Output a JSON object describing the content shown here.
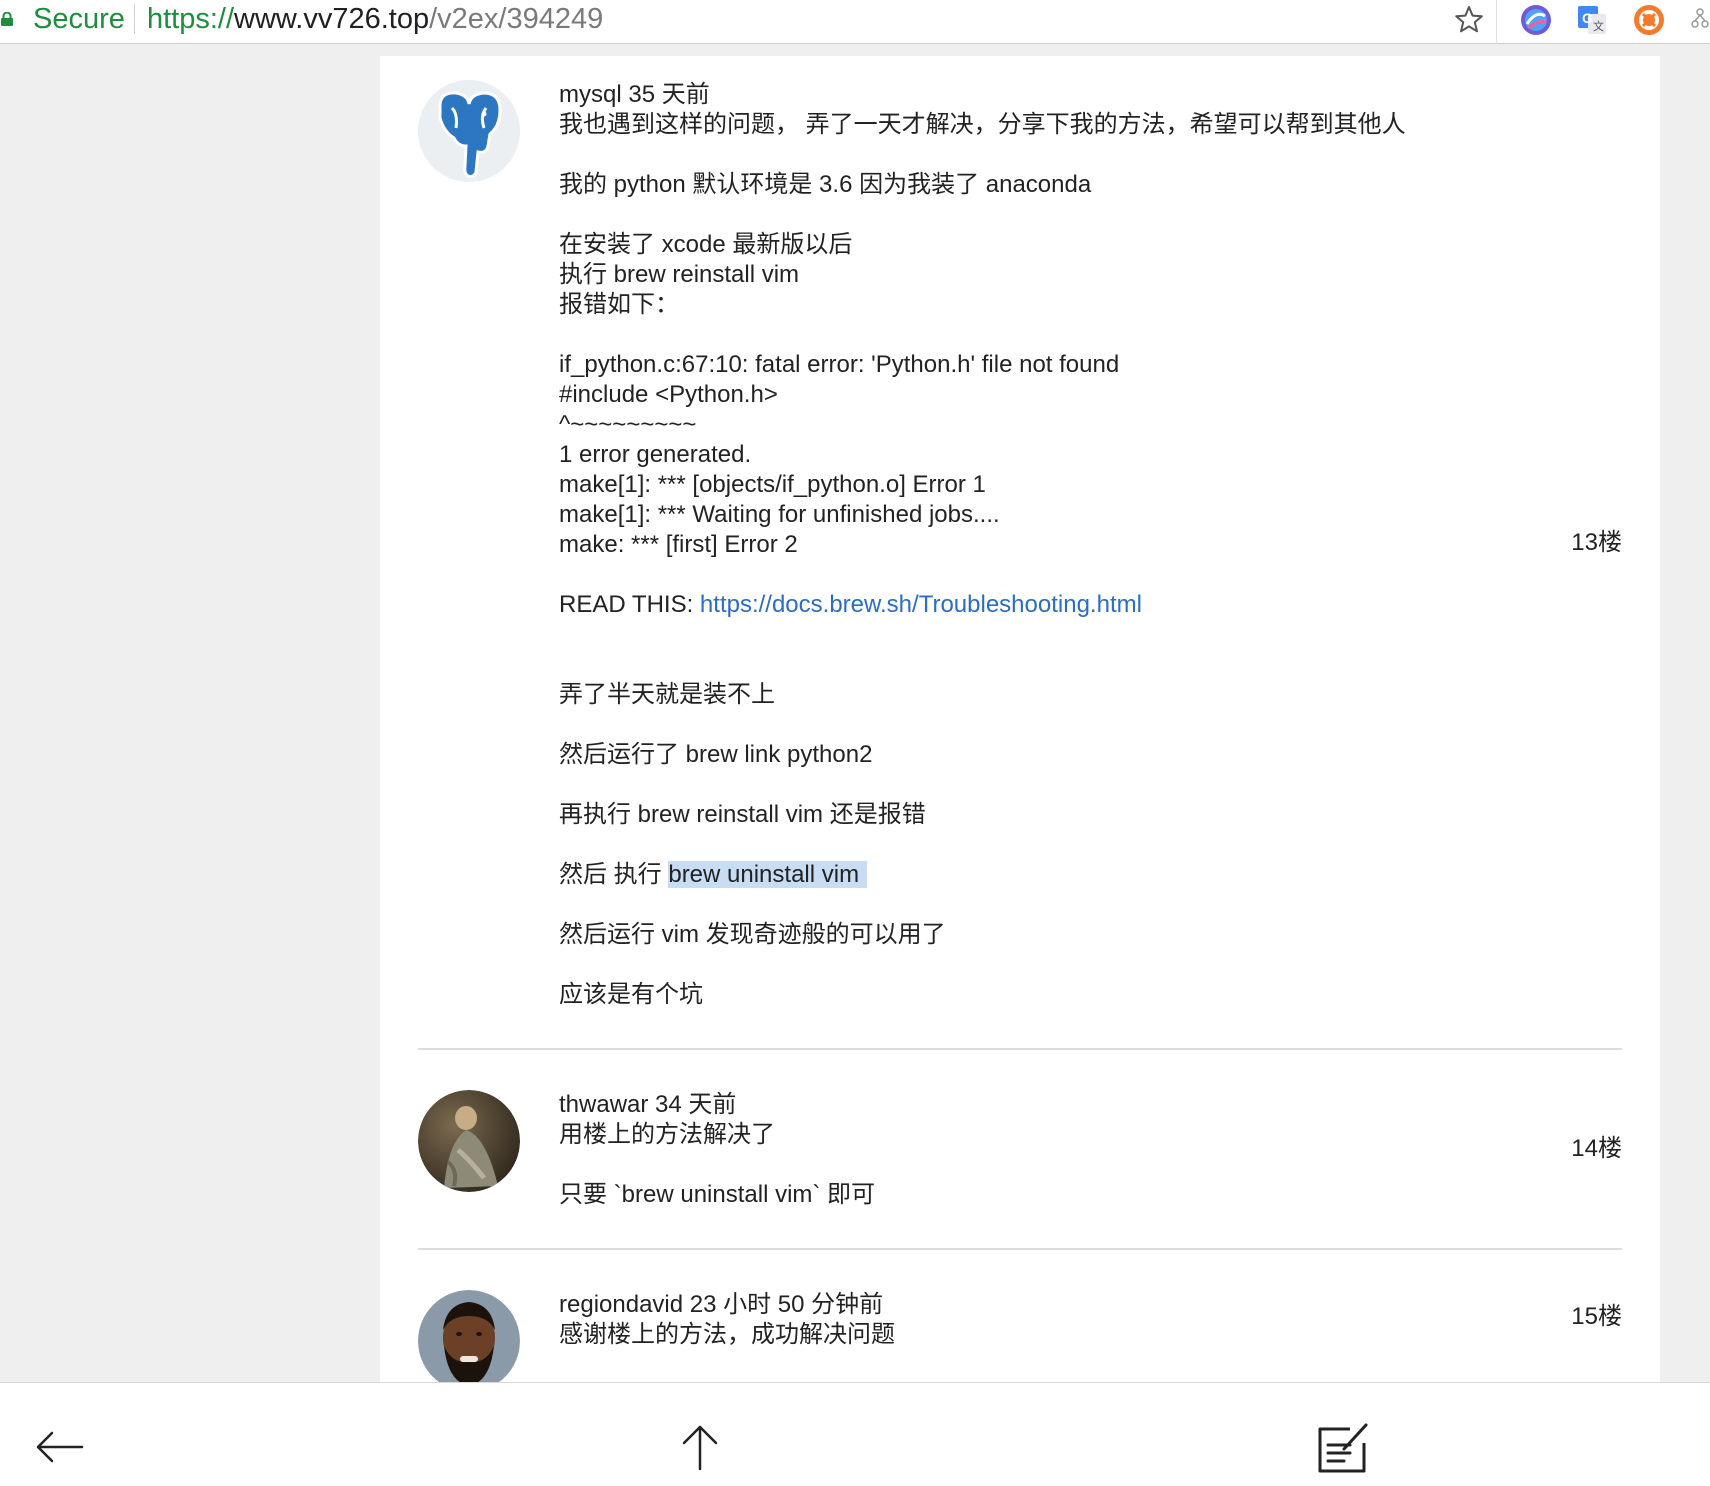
{
  "browser": {
    "secure_label": "Secure",
    "url_scheme": "https://",
    "url_host": "www.vv726.top",
    "url_path": "/v2ex/394249"
  },
  "replies": [
    {
      "username": "mysql",
      "time": "35 天前",
      "floor": "13楼",
      "lines": [
        "我也遇到这样的问题， 弄了一天才解决，分享下我的方法，希望可以帮到其他人",
        "",
        "我的 python 默认环境是 3.6 因为我装了 anaconda",
        "",
        "在安装了 xcode 最新版以后",
        "执行 brew reinstall vim",
        "报错如下：",
        "",
        "if_python.c:67:10: fatal error: 'Python.h' file not found",
        "#include <Python.h>",
        "^~~~~~~~~~",
        "1 error generated.",
        "make[1]: *** [objects/if_python.o] Error 1",
        "make[1]: *** Waiting for unfinished jobs....",
        "make: *** [first] Error 2",
        "",
        "READ THIS: ",
        "",
        "",
        "弄了半天就是装不上",
        "",
        "然后运行了 brew link python2",
        "",
        "再执行 brew reinstall vim 还是报错",
        "",
        "然后 执行 ",
        "",
        "然后运行 vim 发现奇迹般的可以用了",
        "",
        "应该是有个坑"
      ],
      "link": "https://docs.brew.sh/Troubleshooting.html",
      "highlight": "brew uninstall vim"
    },
    {
      "username": "thwawar",
      "time": "34 天前",
      "floor": "14楼",
      "lines": [
        "用楼上的方法解决了",
        "",
        "只要 `brew uninstall vim` 即可"
      ]
    },
    {
      "username": "regiondavid",
      "time": "23 小时 50 分钟前",
      "floor": "15楼",
      "lines": [
        "感谢楼上的方法，成功解决问题"
      ]
    }
  ],
  "icons": {
    "lock": "lock-icon",
    "star": "bookmark-star-icon",
    "back": "back-arrow-icon",
    "top": "scroll-top-icon",
    "compose": "compose-icon",
    "avatar1": "postgresql-elephant-avatar",
    "avatar2": "painting-avatar",
    "avatar3": "bearded-man-avatar"
  },
  "colors": {
    "secure_green": "#1e8e3e",
    "link_blue": "#2b6cc4",
    "selection": "#c8dcf4"
  }
}
